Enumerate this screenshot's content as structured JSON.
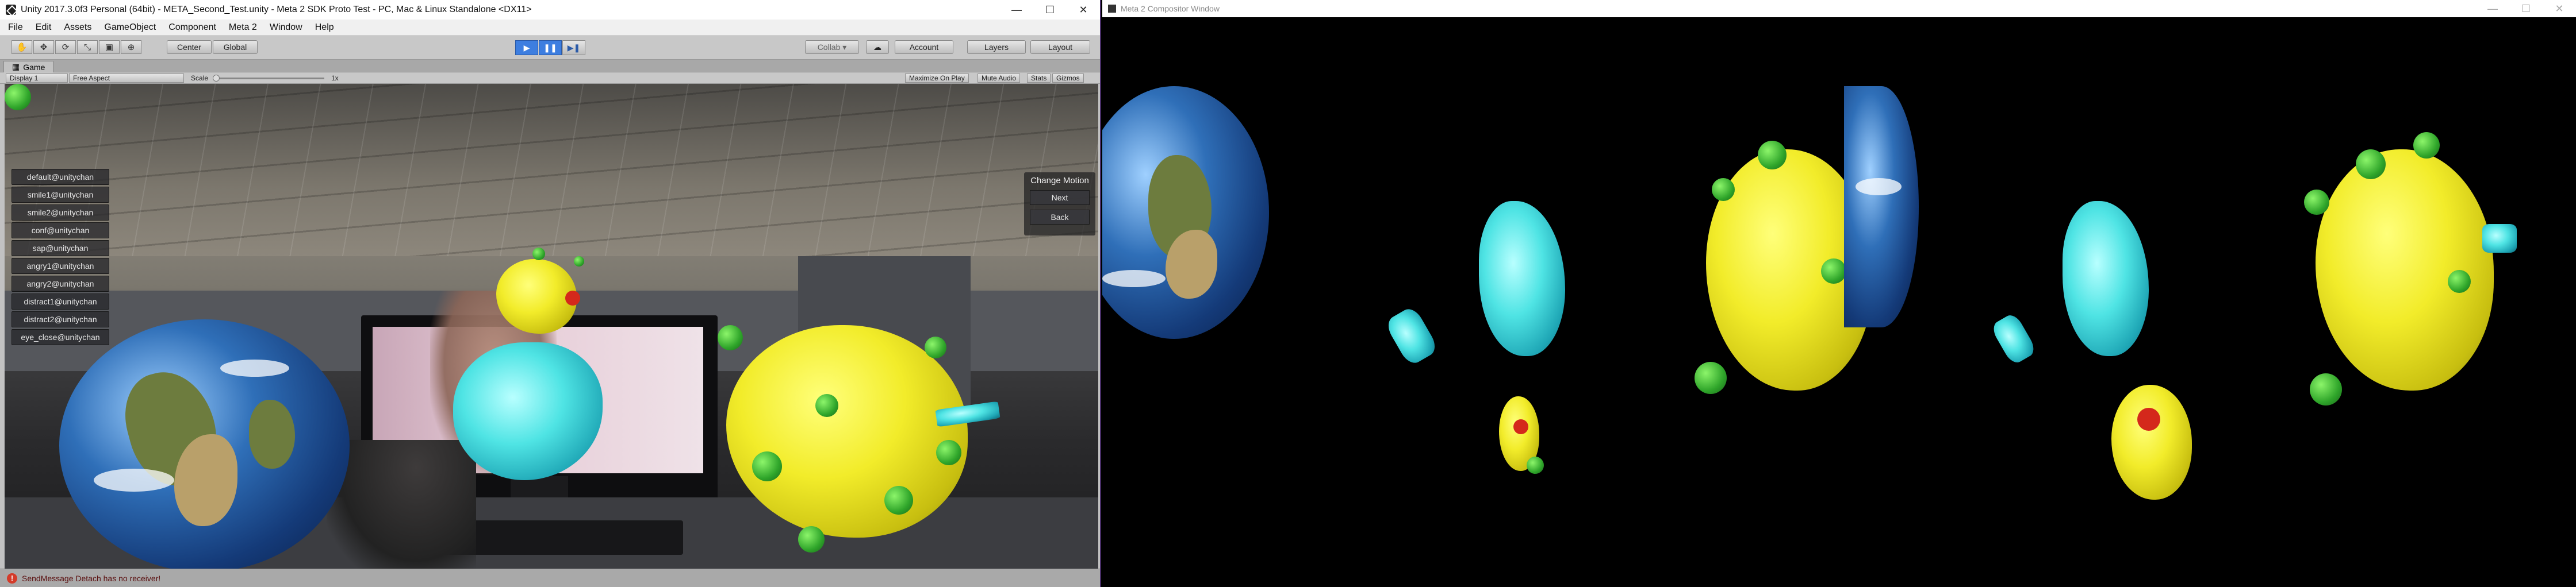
{
  "unity": {
    "title": "Unity 2017.3.0f3 Personal (64bit) - META_Second_Test.unity - Meta 2 SDK Proto Test - PC, Mac & Linux Standalone <DX11>",
    "window_controls": {
      "minimize": "—",
      "maximize": "☐",
      "close": "✕"
    },
    "menu": [
      "File",
      "Edit",
      "Assets",
      "GameObject",
      "Component",
      "Meta 2",
      "Window",
      "Help"
    ],
    "toolbar": {
      "tools": [
        "hand-icon",
        "move-icon",
        "rotate-icon",
        "scale-icon",
        "rect-icon",
        "transform-icon"
      ],
      "pivot_label": "Center",
      "space_label": "Global",
      "play_glyph": "▶",
      "pause_glyph": "❚❚",
      "step_glyph": "▶❚",
      "collab_label": "Collab ▾",
      "cloud_glyph": "☁",
      "account_label": "Account",
      "layers_label": "Layers",
      "layout_label": "Layout"
    },
    "game_tab": {
      "label": "Game"
    },
    "game_options": {
      "display": "Display 1",
      "aspect": "Free Aspect",
      "scale_label": "Scale",
      "scale_value": "1x",
      "maximize_on_play": "Maximize On Play",
      "mute_audio": "Mute Audio",
      "stats": "Stats",
      "gizmos": "Gizmos"
    },
    "motions": [
      "default@unitychan",
      "smile1@unitychan",
      "smile2@unitychan",
      "conf@unitychan",
      "sap@unitychan",
      "angry1@unitychan",
      "angry2@unitychan",
      "distract1@unitychan",
      "distract2@unitychan",
      "eye_close@unitychan"
    ],
    "change_motion": {
      "title": "Change Motion",
      "next": "Next",
      "back": "Back"
    },
    "status": {
      "icon": "error-icon",
      "message": "SendMessage Detach has no receiver!"
    }
  },
  "compositor": {
    "title": "Meta 2 Compositor Window",
    "window_controls": {
      "minimize": "—",
      "maximize": "☐",
      "close": "✕"
    }
  },
  "colors": {
    "play_accent": "#3d7ee0",
    "error": "#d43b2a",
    "blob_yellow": "#f2ec2a",
    "blob_cyan": "#4fe4e4",
    "bump_green": "#2fa52a"
  }
}
